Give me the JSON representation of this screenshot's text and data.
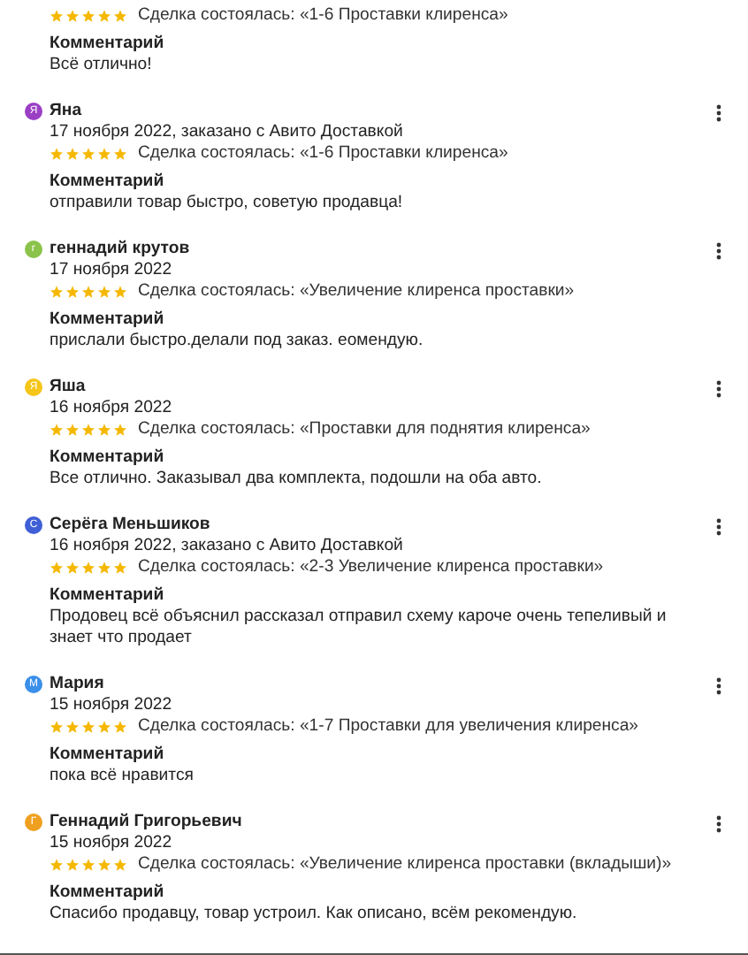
{
  "reviews": [
    {
      "deal": "Сделка состоялась: «1-6 Проставки клиренса»",
      "stars": 5,
      "comment_label": "Комментарий",
      "comment": "Всё отлично!"
    },
    {
      "name": "Яна",
      "avatar": {
        "letter": "Я",
        "color": "#9b3fc4"
      },
      "date": "17 ноября 2022, заказано с Авито Доставкой",
      "stars": 5,
      "deal": "Сделка состоялась: «1-6 Проставки клиренса»",
      "comment_label": "Комментарий",
      "comment": "отправили товар быстро, советую продавца!"
    },
    {
      "name": "геннадий крутов",
      "avatar": {
        "letter": "г",
        "color": "#8bc34a"
      },
      "date": "17 ноября 2022",
      "stars": 5,
      "deal": "Сделка состоялась: «Увеличение клиренса проставки»",
      "comment_label": "Комментарий",
      "comment": "прислали быстро.делали под заказ. еомендую."
    },
    {
      "name": "Яша",
      "avatar": {
        "letter": "Я",
        "color": "#f5c518"
      },
      "date": "16 ноября 2022",
      "stars": 5,
      "deal": "Сделка состоялась: «Проставки для поднятия клиренса»",
      "comment_label": "Комментарий",
      "comment": "Все отлично. Заказывал два комплекта, подошли на оба авто."
    },
    {
      "name": "Серёга Меньшиков",
      "avatar": {
        "letter": "С",
        "color": "#3f5fd6"
      },
      "date": "16 ноября 2022, заказано с Авито Доставкой",
      "stars": 5,
      "deal": "Сделка состоялась: «2-3 Увеличение клиренса проставки»",
      "comment_label": "Комментарий",
      "comment": "Продовец всё объяснил рассказал отправил схему кароче очень тепеливый и знает что продает"
    },
    {
      "name": "Мария",
      "avatar": {
        "letter": "М",
        "color": "#3b8fe8"
      },
      "date": "15 ноября 2022",
      "stars": 5,
      "deal": "Сделка состоялась: «1-7 Проставки для увеличения клиренса»",
      "comment_label": "Комментарий",
      "comment": "пока всё нравится"
    },
    {
      "name": "Геннадий Григорьевич",
      "avatar": {
        "letter": "Г",
        "color": "#f0a020"
      },
      "date": "15 ноября 2022",
      "stars": 5,
      "deal": "Сделка состоялась: «Увеличение клиренса проставки (вкладыши)»",
      "comment_label": "Комментарий",
      "comment": "Спасибо продавцу, товар устроил. Как описано, всём рекомендую."
    }
  ]
}
